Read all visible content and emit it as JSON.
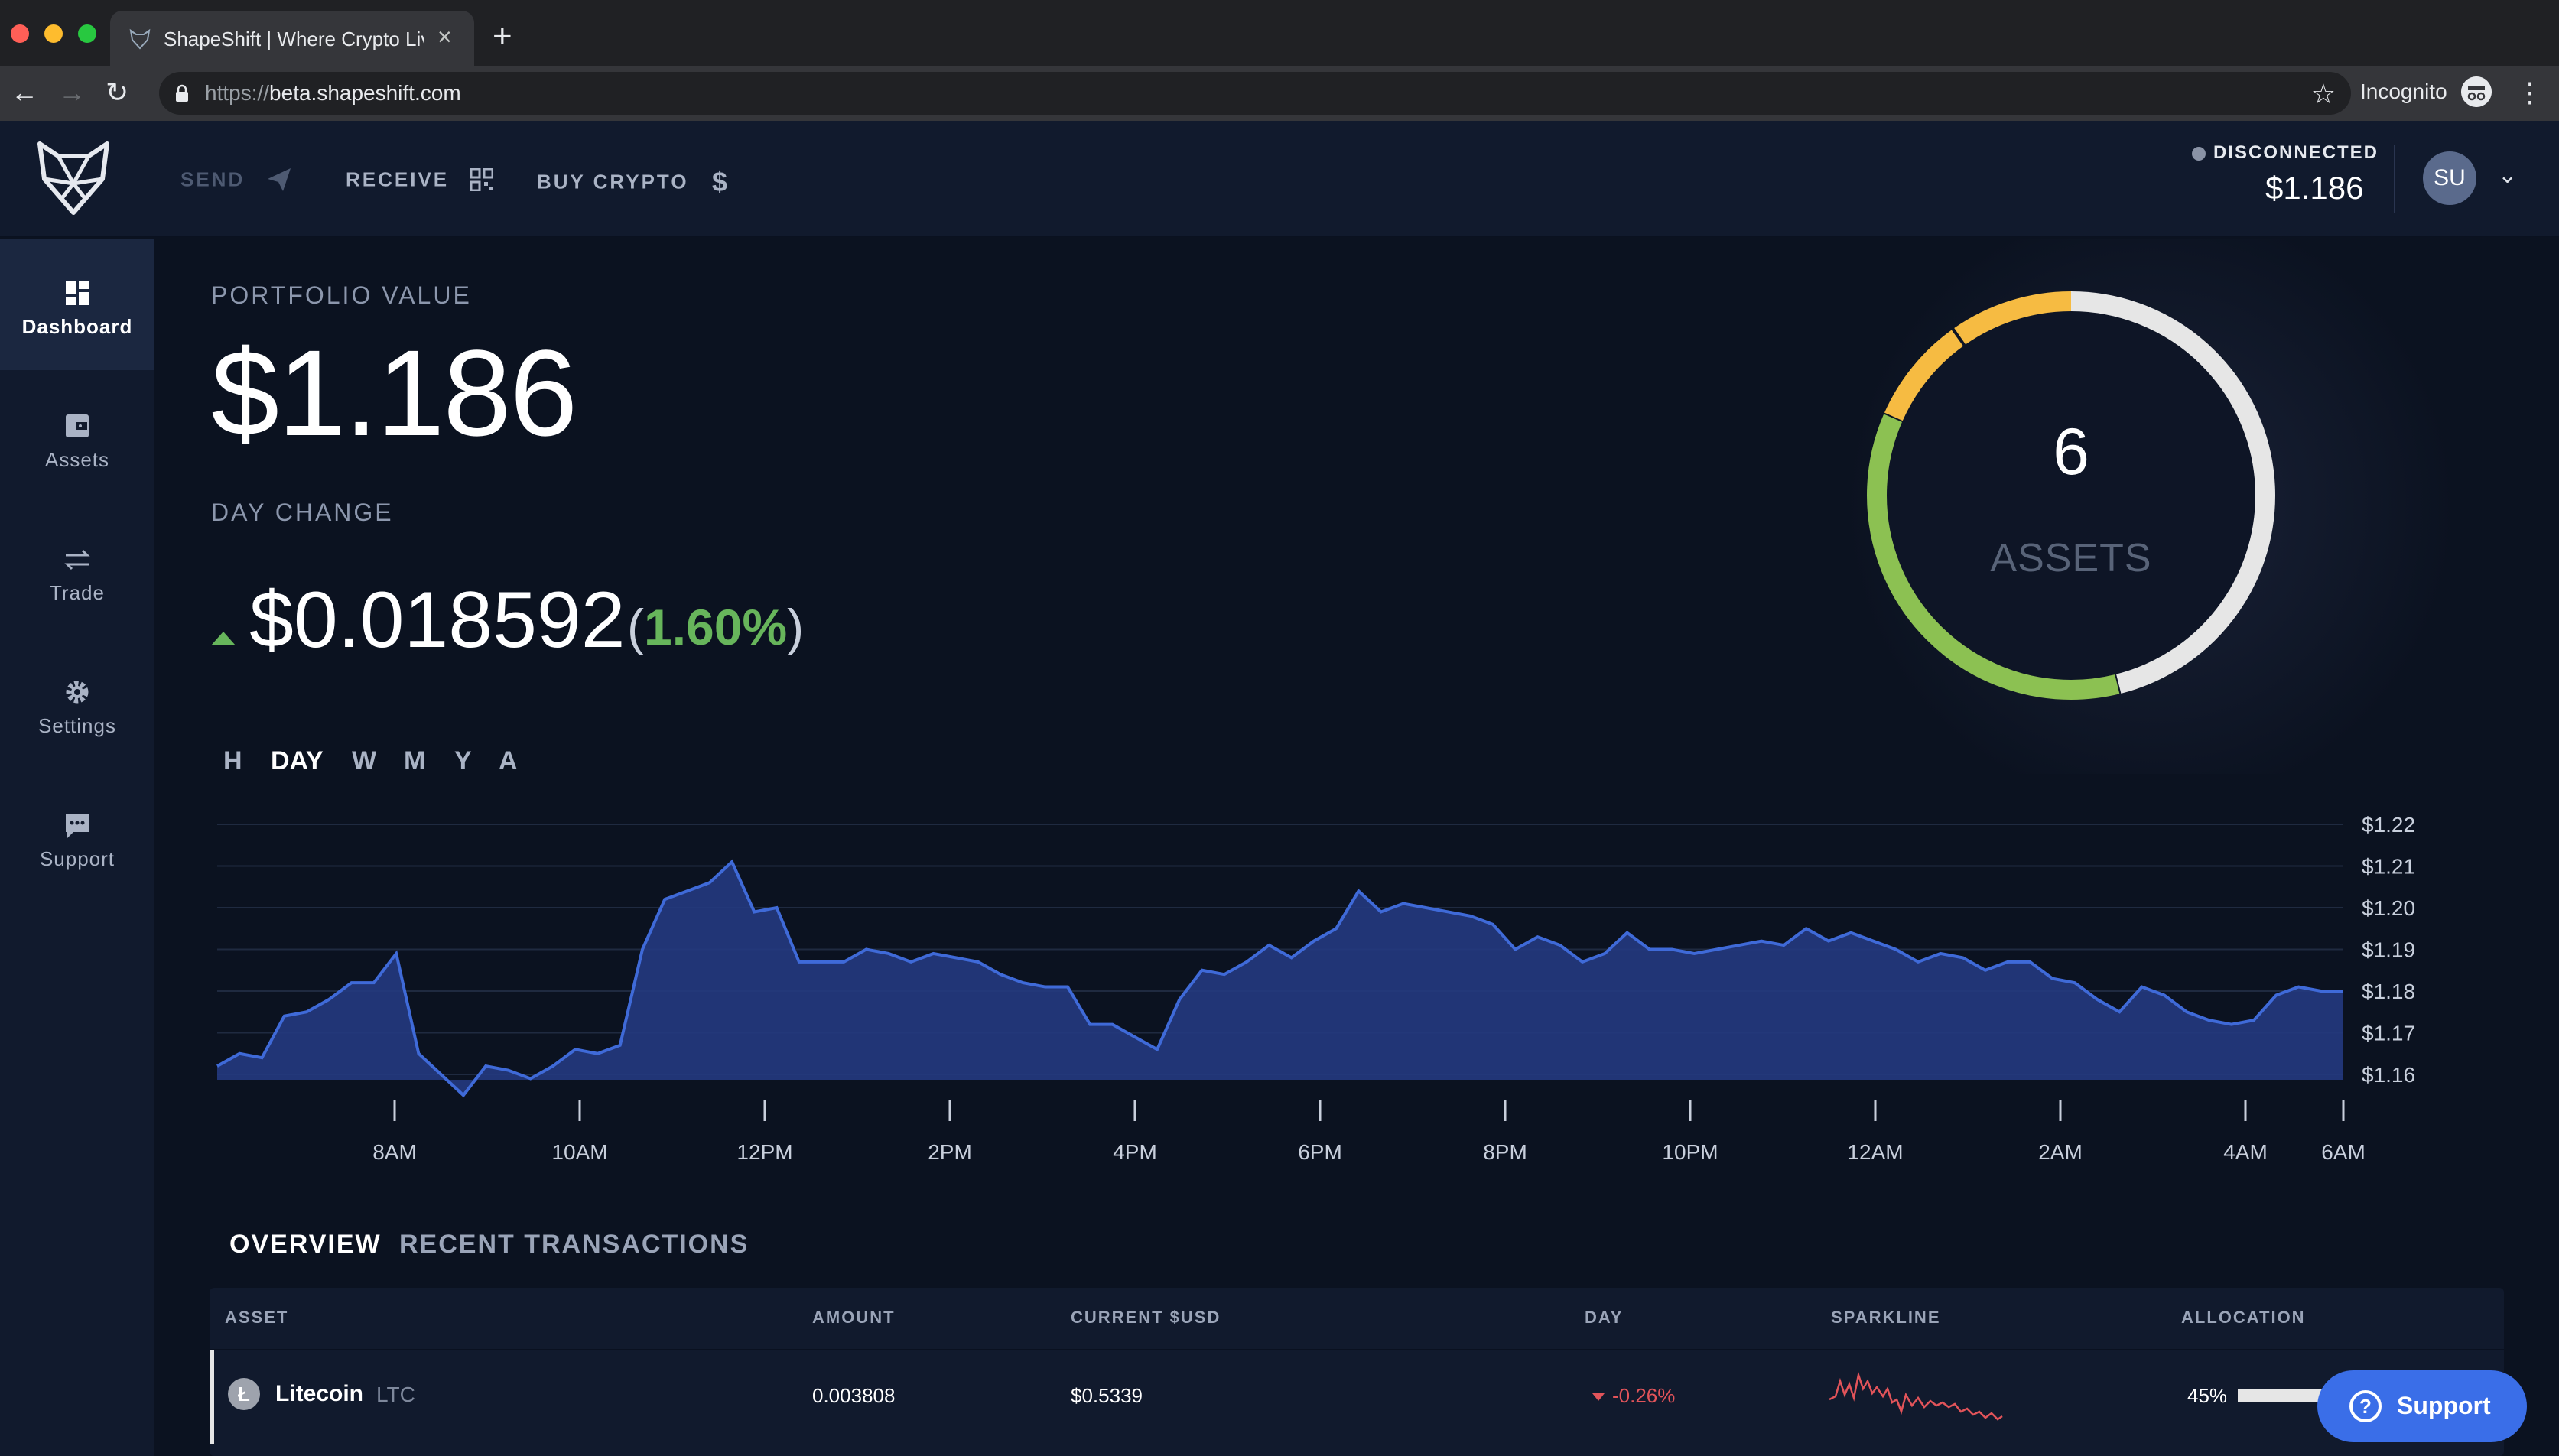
{
  "browser": {
    "tab_title": "ShapeShift | Where Crypto Live",
    "url_prefix": "https://",
    "url_host": "beta.shapeshift.com",
    "incognito_label": "Incognito"
  },
  "header": {
    "nav": [
      {
        "label": "SEND",
        "icon": "send-icon",
        "enabled": false
      },
      {
        "label": "RECEIVE",
        "icon": "qr-code-icon",
        "enabled": true
      },
      {
        "label": "BUY CRYPTO",
        "icon": "dollar-icon",
        "enabled": true
      }
    ],
    "status": "DISCONNECTED",
    "balance": "$1.186",
    "avatar_initials": "SU"
  },
  "sidebar": {
    "items": [
      {
        "label": "Dashboard",
        "icon": "dashboard-icon",
        "active": true
      },
      {
        "label": "Assets",
        "icon": "wallet-icon",
        "active": false
      },
      {
        "label": "Trade",
        "icon": "swap-icon",
        "active": false
      },
      {
        "label": "Settings",
        "icon": "gear-icon",
        "active": false
      },
      {
        "label": "Support",
        "icon": "chat-icon",
        "active": false
      }
    ]
  },
  "portfolio": {
    "label": "PORTFOLIO VALUE",
    "value": "$1.186",
    "day_change_label": "DAY CHANGE",
    "day_change_value": "$0.018592",
    "day_change_pct": "1.60%",
    "paren_open": "(",
    "paren_close": ")"
  },
  "assets_donut": {
    "count": "6",
    "label": "ASSETS",
    "colors": {
      "white": "#e6e6e6",
      "green": "#8cc152",
      "yellow": "#f6bb42"
    }
  },
  "time_ranges": [
    {
      "label": "H",
      "active": false
    },
    {
      "label": "DAY",
      "active": true
    },
    {
      "label": "W",
      "active": false
    },
    {
      "label": "M",
      "active": false
    },
    {
      "label": "Y",
      "active": false
    },
    {
      "label": "A",
      "active": false
    }
  ],
  "chart_data": {
    "type": "area",
    "y_ticks": [
      "$1.22",
      "$1.21",
      "$1.20",
      "$1.19",
      "$1.18",
      "$1.17",
      "$1.16"
    ],
    "x_ticks": [
      "8AM",
      "10AM",
      "12PM",
      "2PM",
      "4PM",
      "6PM",
      "8PM",
      "10PM",
      "12AM",
      "2AM",
      "4AM",
      "6AM"
    ],
    "ylim": [
      1.155,
      1.22
    ],
    "values": [
      1.162,
      1.165,
      1.164,
      1.174,
      1.175,
      1.178,
      1.182,
      1.182,
      1.189,
      1.165,
      1.16,
      1.155,
      1.162,
      1.161,
      1.159,
      1.162,
      1.166,
      1.165,
      1.167,
      1.19,
      1.202,
      1.204,
      1.206,
      1.211,
      1.199,
      1.2,
      1.187,
      1.187,
      1.187,
      1.19,
      1.189,
      1.187,
      1.189,
      1.188,
      1.187,
      1.184,
      1.182,
      1.181,
      1.181,
      1.172,
      1.172,
      1.169,
      1.166,
      1.178,
      1.185,
      1.184,
      1.187,
      1.191,
      1.188,
      1.192,
      1.195,
      1.204,
      1.199,
      1.201,
      1.2,
      1.199,
      1.198,
      1.196,
      1.19,
      1.193,
      1.191,
      1.187,
      1.189,
      1.194,
      1.19,
      1.19,
      1.189,
      1.19,
      1.191,
      1.192,
      1.191,
      1.195,
      1.192,
      1.194,
      1.192,
      1.19,
      1.187,
      1.189,
      1.188,
      1.185,
      1.187,
      1.187,
      1.183,
      1.182,
      1.178,
      1.175,
      1.181,
      1.179,
      1.175,
      1.173,
      1.172,
      1.173,
      1.179,
      1.181,
      1.18,
      1.18
    ],
    "color": "#3f6ad8"
  },
  "section_tabs": [
    {
      "label": "OVERVIEW",
      "active": true
    },
    {
      "label": "RECENT TRANSACTIONS",
      "active": false
    }
  ],
  "table": {
    "headers": [
      "ASSET",
      "AMOUNT",
      "CURRENT $USD",
      "DAY",
      "SPARKLINE",
      "ALLOCATION"
    ],
    "rows": [
      {
        "name": "Litecoin",
        "symbol": "LTC",
        "amount": "0.003808",
        "usd": "$0.5339",
        "day": "-0.26%",
        "allocation": "45%",
        "allocation_value": 0.45,
        "coin_letter": "Ł"
      }
    ]
  },
  "support_button": {
    "label": "Support"
  }
}
